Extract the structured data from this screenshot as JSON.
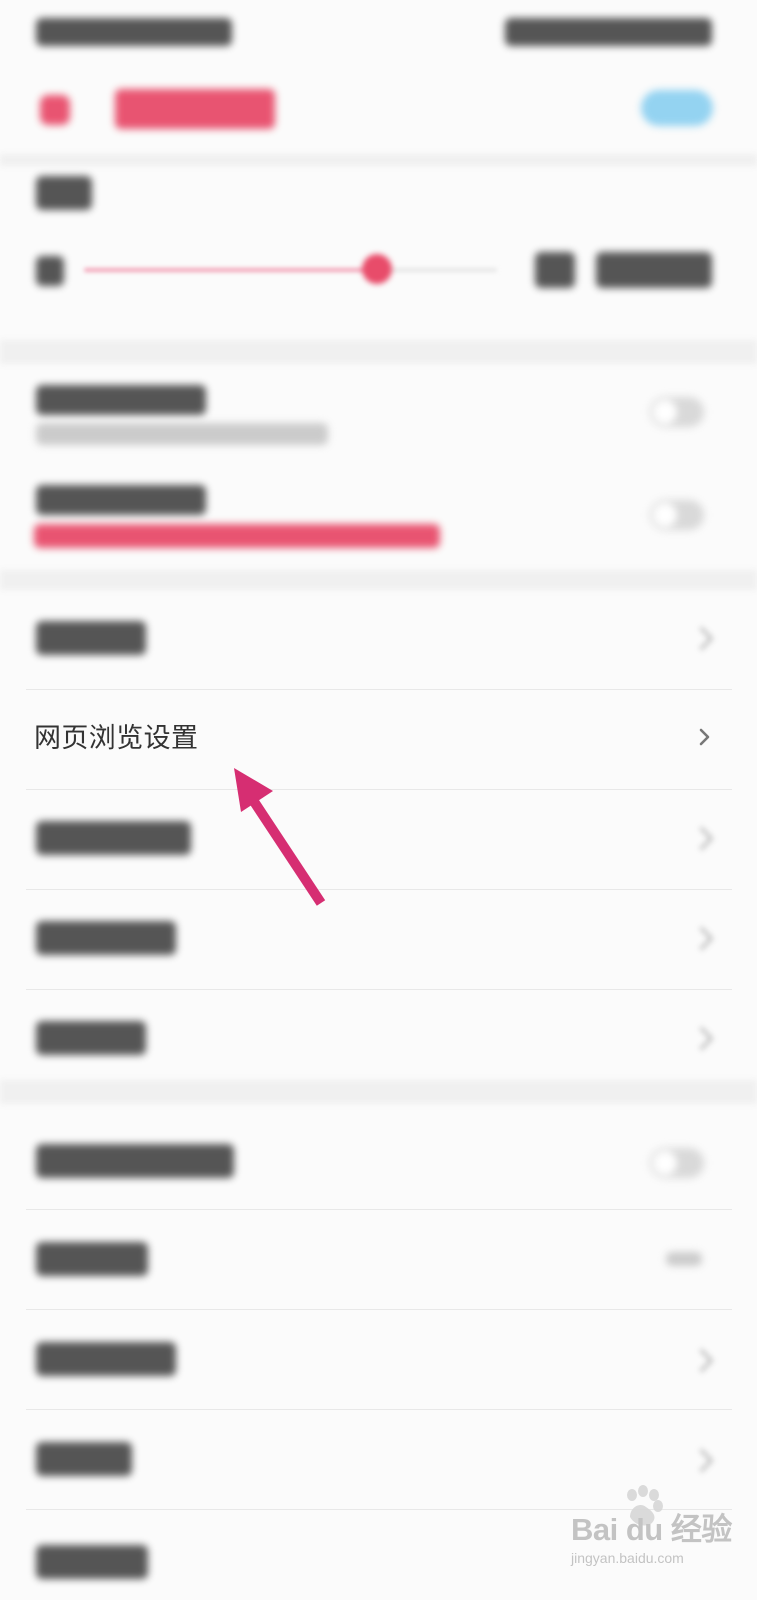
{
  "settings": {
    "items": [
      {
        "label": "网页浏览设置"
      }
    ]
  },
  "annotation": {
    "arrow_color": "#d62e72"
  },
  "watermark": {
    "brand": "Bai du 经验",
    "url": "jingyan.baidu.com"
  },
  "colors": {
    "accent_pink": "#e84c6a",
    "accent_blue": "#8fd1f1",
    "divider": "#e8e8e8"
  },
  "icons": {
    "back": "back-arrow-icon",
    "chevron": "chevron-right-icon",
    "paw": "baidu-paw-icon"
  }
}
